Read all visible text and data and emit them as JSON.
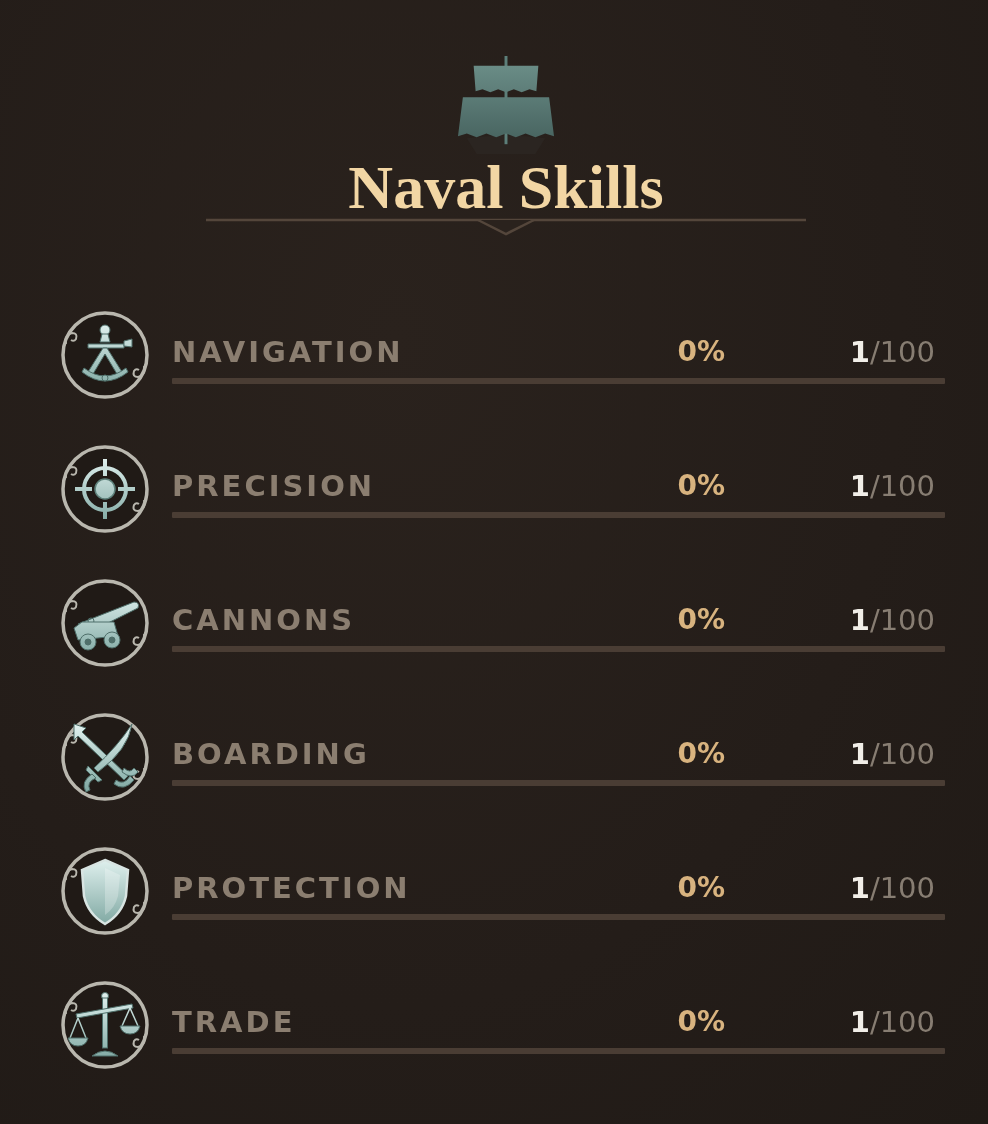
{
  "header": {
    "title": "Naval Skills"
  },
  "skills": [
    {
      "name": "NAVIGATION",
      "percent": "0%",
      "level": 0,
      "rank": "**1**/100"
    },
    {
      "name": "PRECISION",
      "percent": "0%",
      "level": 0,
      "rank": "**1**/100"
    },
    {
      "name": "CANNONS",
      "percent": "0%",
      "level": 0,
      "rank": "**1**/100"
    },
    {
      "name": "BOARDING",
      "percent": "0%",
      "level": 0,
      "rank": "**1**/100"
    },
    {
      "name": "PROTECTION",
      "percent": "0%",
      "level": 0,
      "rank": "**1**/100"
    },
    {
      "name": "TRADE",
      "percent": "0%",
      "level": 0,
      "rank": "**1**/100"
    }
  ]
}
